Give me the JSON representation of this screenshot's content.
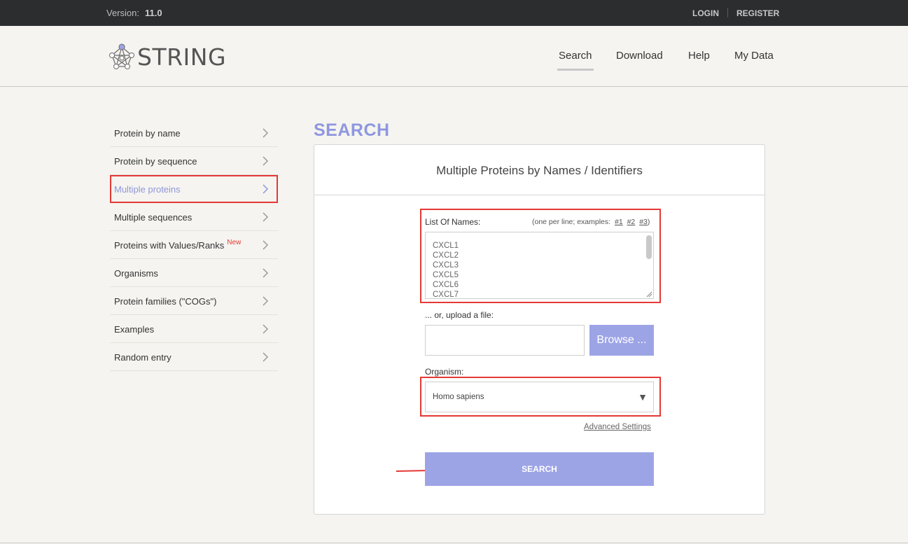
{
  "topbar": {
    "version_label": "Version:",
    "version_value": "11.0",
    "login": "LOGIN",
    "register": "REGISTER"
  },
  "header": {
    "logo_text": "STRING",
    "nav": [
      "Search",
      "Download",
      "Help",
      "My Data"
    ],
    "active_nav": "Search"
  },
  "sidebar": {
    "items": [
      {
        "label": "Protein by name"
      },
      {
        "label": "Protein by sequence"
      },
      {
        "label": "Multiple proteins"
      },
      {
        "label": "Multiple sequences"
      },
      {
        "label": "Proteins with Values/Ranks",
        "badge": "New"
      },
      {
        "label": "Organisms"
      },
      {
        "label": "Protein families (\"COGs\")"
      },
      {
        "label": "Examples"
      },
      {
        "label": "Random entry"
      }
    ],
    "active_index": 2
  },
  "main": {
    "title": "SEARCH",
    "panel_title": "Multiple Proteins by Names / Identifiers",
    "names_label": "List Of Names:",
    "names_hint_prefix": "(one per line; examples:",
    "examples": [
      "#1",
      "#2",
      "#3"
    ],
    "names_hint_suffix": ")",
    "names_value": [
      "CXCL1",
      "CXCL2",
      "CXCL3",
      "CXCL5",
      "CXCL6",
      "CXCL7"
    ],
    "upload_label": "... or, upload a file:",
    "browse_label": "Browse ...",
    "organism_label": "Organism:",
    "organism_value": "Homo sapiens",
    "advanced_settings": "Advanced Settings",
    "search_button": "SEARCH"
  },
  "colors": {
    "accent": "#8f97e0",
    "button": "#9da4e6",
    "highlight": "#e53935",
    "topbar": "#2c2d2f"
  }
}
